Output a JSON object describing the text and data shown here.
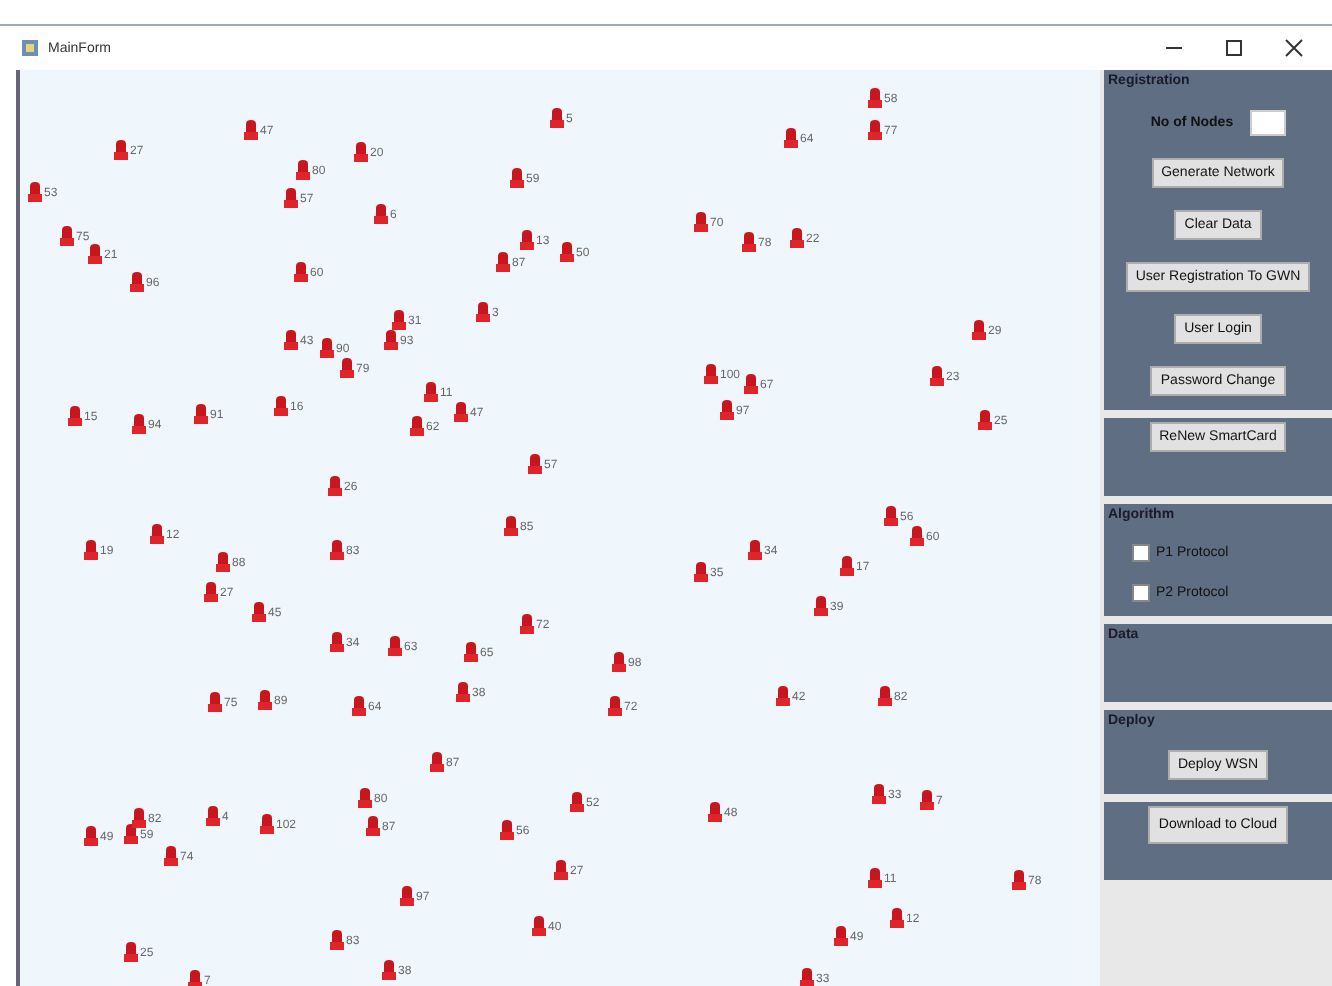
{
  "window": {
    "title": "MainForm"
  },
  "canvas": {
    "nodes": [
      {
        "label": "58"
      },
      {
        "label": "5"
      },
      {
        "label": "47"
      },
      {
        "label": "64"
      },
      {
        "label": "77"
      },
      {
        "label": "27"
      },
      {
        "label": "20"
      },
      {
        "label": "80"
      },
      {
        "label": "59"
      },
      {
        "label": "53"
      },
      {
        "label": "57"
      },
      {
        "label": "6"
      },
      {
        "label": "70"
      },
      {
        "label": "75"
      },
      {
        "label": "13"
      },
      {
        "label": "78"
      },
      {
        "label": "22"
      },
      {
        "label": "21"
      },
      {
        "label": "87"
      },
      {
        "label": "50"
      },
      {
        "label": "96"
      },
      {
        "label": "60"
      },
      {
        "label": "31"
      },
      {
        "label": "3"
      },
      {
        "label": "29"
      },
      {
        "label": "43"
      },
      {
        "label": "90"
      },
      {
        "label": "93"
      },
      {
        "label": "79"
      },
      {
        "label": "100"
      },
      {
        "label": "67"
      },
      {
        "label": "23"
      },
      {
        "label": "11"
      },
      {
        "label": "15"
      },
      {
        "label": "94"
      },
      {
        "label": "91"
      },
      {
        "label": "16"
      },
      {
        "label": "62"
      },
      {
        "label": "47"
      },
      {
        "label": "97"
      },
      {
        "label": "25"
      },
      {
        "label": "57"
      },
      {
        "label": "26"
      },
      {
        "label": "12"
      },
      {
        "label": "85"
      },
      {
        "label": "56"
      },
      {
        "label": "60"
      },
      {
        "label": "19"
      },
      {
        "label": "88"
      },
      {
        "label": "83"
      },
      {
        "label": "35"
      },
      {
        "label": "34"
      },
      {
        "label": "17"
      },
      {
        "label": "27"
      },
      {
        "label": "45"
      },
      {
        "label": "72"
      },
      {
        "label": "39"
      },
      {
        "label": "34"
      },
      {
        "label": "63"
      },
      {
        "label": "65"
      },
      {
        "label": "98"
      },
      {
        "label": "75"
      },
      {
        "label": "89"
      },
      {
        "label": "64"
      },
      {
        "label": "38"
      },
      {
        "label": "72"
      },
      {
        "label": "42"
      },
      {
        "label": "82"
      },
      {
        "label": "87"
      },
      {
        "label": "80"
      },
      {
        "label": "52"
      },
      {
        "label": "33"
      },
      {
        "label": "7"
      },
      {
        "label": "49"
      },
      {
        "label": "59"
      },
      {
        "label": "82"
      },
      {
        "label": "4"
      },
      {
        "label": "102"
      },
      {
        "label": "87"
      },
      {
        "label": "56"
      },
      {
        "label": "48"
      },
      {
        "label": "74"
      },
      {
        "label": "27"
      },
      {
        "label": "11"
      },
      {
        "label": "78"
      },
      {
        "label": "97"
      },
      {
        "label": "40"
      },
      {
        "label": "12"
      },
      {
        "label": "25"
      },
      {
        "label": "83"
      },
      {
        "label": "49"
      },
      {
        "label": "7"
      },
      {
        "label": "38"
      },
      {
        "label": "33"
      }
    ]
  },
  "panels": [
    {
      "title": "Registration",
      "items": [
        {
          "kind": "field",
          "label": "No of Nodes"
        },
        {
          "kind": "button",
          "label": "Generate Network"
        },
        {
          "kind": "button",
          "label": "Clear Data"
        },
        {
          "kind": "button",
          "label": "User Registration To GWN"
        },
        {
          "kind": "button",
          "label": "User Login"
        },
        {
          "kind": "button",
          "label": "Password Change"
        }
      ]
    },
    {
      "items": [
        {
          "kind": "button",
          "label": "ReNew SmartCard"
        }
      ]
    },
    {
      "title": "Algorithm",
      "items": [
        {
          "kind": "checkbox",
          "label": "P1 Protocol",
          "checked": false
        },
        {
          "kind": "checkbox",
          "label": "P2 Protocol",
          "checked": false
        }
      ]
    },
    {
      "title": "Data"
    },
    {
      "title": "Deploy",
      "items": [
        {
          "kind": "button",
          "label": "Deploy WSN"
        }
      ]
    },
    {
      "items": [
        {
          "kind": "button",
          "label": "Download to Cloud"
        }
      ]
    }
  ]
}
